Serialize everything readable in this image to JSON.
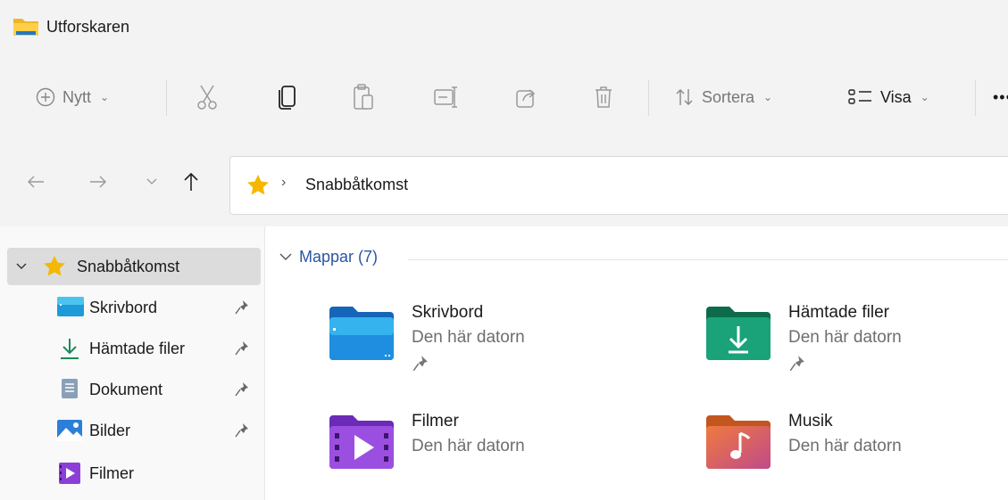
{
  "window": {
    "title": "Utforskaren"
  },
  "toolbar": {
    "new_label": "Nytt",
    "sort_label": "Sortera",
    "view_label": "Visa",
    "more_label": "•••"
  },
  "address": {
    "crumbs": [
      "Snabbåtkomst"
    ]
  },
  "sidebar": {
    "items": [
      {
        "label": "Snabbåtkomst",
        "icon": "star-icon",
        "selected": true,
        "expanded": true
      },
      {
        "label": "Skrivbord",
        "icon": "desktop-folder-icon",
        "pinned": true
      },
      {
        "label": "Hämtade filer",
        "icon": "download-icon",
        "pinned": true
      },
      {
        "label": "Dokument",
        "icon": "document-icon",
        "pinned": true
      },
      {
        "label": "Bilder",
        "icon": "pictures-icon",
        "pinned": true
      },
      {
        "label": "Filmer",
        "icon": "videos-icon",
        "pinned": false
      }
    ]
  },
  "main": {
    "group": {
      "label": "Mappar (7)"
    },
    "folders": [
      {
        "name": "Skrivbord",
        "location": "Den här datorn",
        "icon": "desktop-folder-icon",
        "pinned": true
      },
      {
        "name": "Hämtade filer",
        "location": "Den här datorn",
        "icon": "downloads-folder-icon",
        "pinned": true
      },
      {
        "name": "Filmer",
        "location": "Den här datorn",
        "icon": "videos-folder-icon",
        "pinned": false
      },
      {
        "name": "Musik",
        "location": "Den här datorn",
        "icon": "music-folder-icon",
        "pinned": false
      }
    ]
  },
  "colors": {
    "accent": "#2b56a3",
    "star": "#f5b800",
    "selection": "#dcdcdc"
  }
}
